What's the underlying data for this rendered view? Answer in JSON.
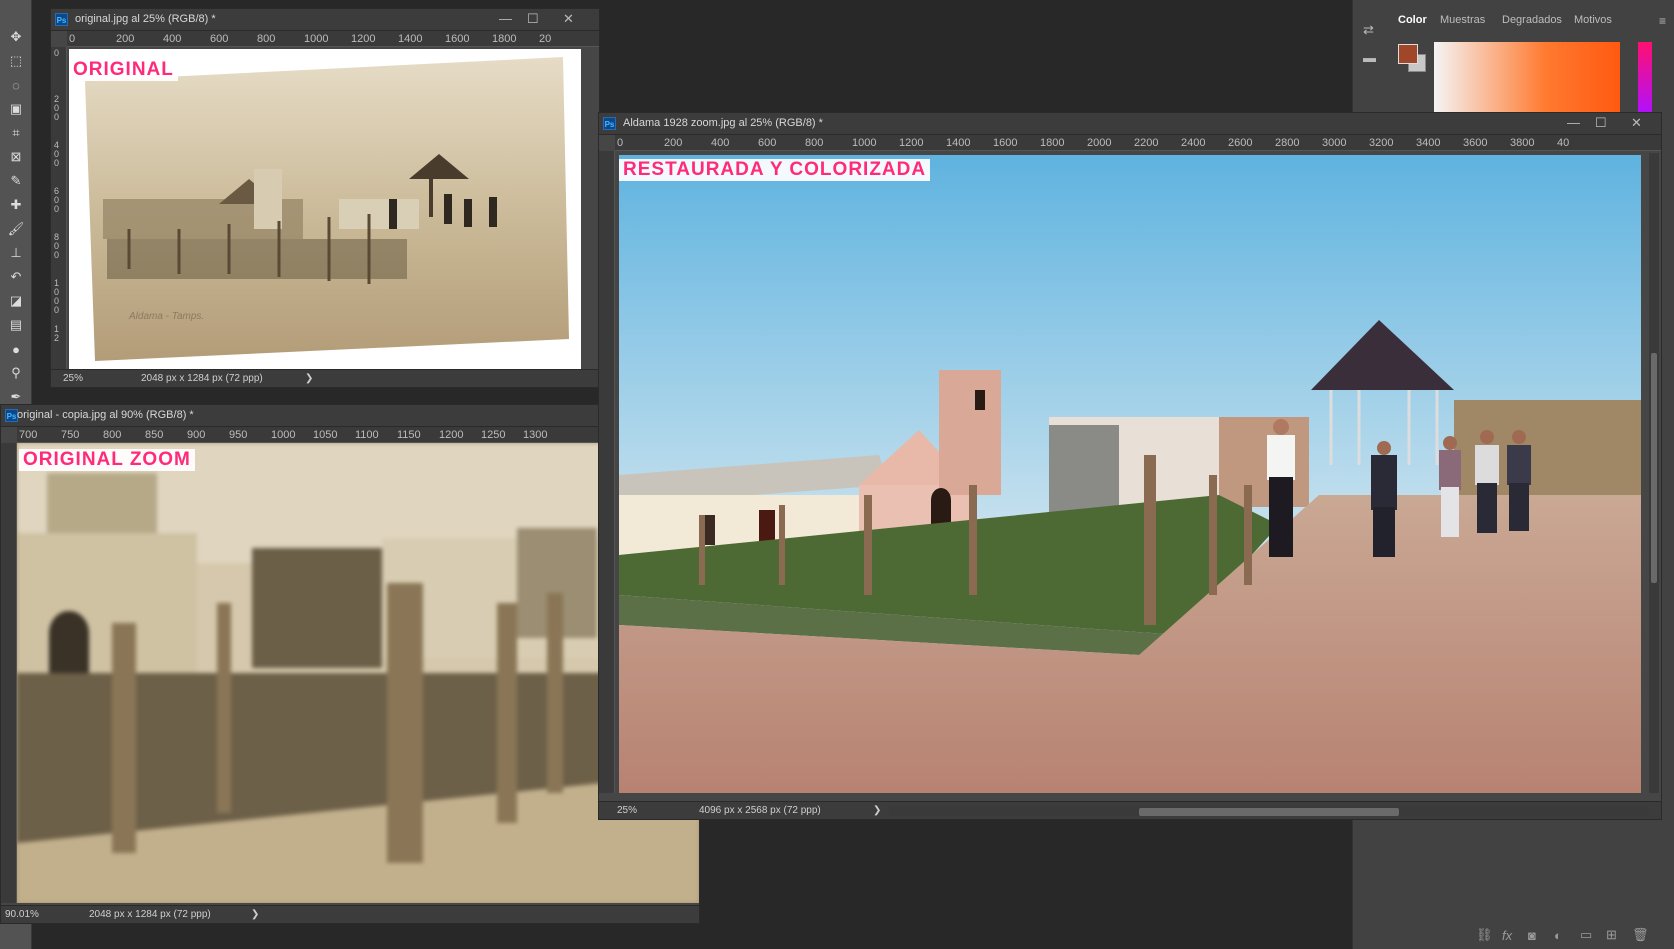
{
  "windows": {
    "original": {
      "title": "original.jpg al 25% (RGB/8) *",
      "label": "ORIGINAL",
      "zoom": "25%",
      "dimensions": "2048 px x 1284 px (72 ppp)",
      "ruler_ticks": [
        "0",
        "200",
        "400",
        "600",
        "800",
        "1000",
        "1200",
        "1400",
        "1600",
        "1800",
        "20"
      ],
      "ruler_v_ticks": [
        "0",
        "2 0 0",
        "4 0 0",
        "6 0 0",
        "8 0 0",
        "1 0 0 0",
        "1 2"
      ]
    },
    "copy": {
      "title": "original - copia.jpg al 90% (RGB/8) *",
      "label": "ORIGINAL ZOOM",
      "zoom": "90.01%",
      "dimensions": "2048 px x 1284 px (72 ppp)",
      "ruler_ticks": [
        "700",
        "750",
        "800",
        "850",
        "900",
        "950",
        "1000",
        "1050",
        "1100",
        "1150",
        "1200",
        "1250",
        "1300"
      ]
    },
    "zoom": {
      "title": "Aldama 1928 zoom.jpg al 25% (RGB/8) *",
      "label": "RESTAURADA Y COLORIZADA",
      "zoom": "25%",
      "dimensions": "4096 px x 2568 px (72 ppp)",
      "ruler_ticks": [
        "0",
        "200",
        "400",
        "600",
        "800",
        "1000",
        "1200",
        "1400",
        "1600",
        "1800",
        "2000",
        "2200",
        "2400",
        "2600",
        "2800",
        "3000",
        "3200",
        "3400",
        "3600",
        "3800",
        "40"
      ]
    }
  },
  "panel": {
    "tabs": [
      "Color",
      "Muestras",
      "Degradados",
      "Motivos"
    ],
    "active_tab": "Color",
    "foreground_color": "#a0472a",
    "background_color": "#c8c8c8"
  },
  "colors": {
    "label_pink": "#ff2a7a",
    "app_bg": "#282828",
    "toolbar_bg": "#535353"
  },
  "icons": [
    "move-icon",
    "marquee-icon",
    "lasso-icon",
    "object-select-icon",
    "crop-icon",
    "frame-icon",
    "eyedropper-icon",
    "healing-icon",
    "brush-icon",
    "stamp-icon",
    "history-brush-icon",
    "eraser-icon",
    "gradient-icon",
    "blur-icon",
    "dodge-icon",
    "pen-icon"
  ]
}
